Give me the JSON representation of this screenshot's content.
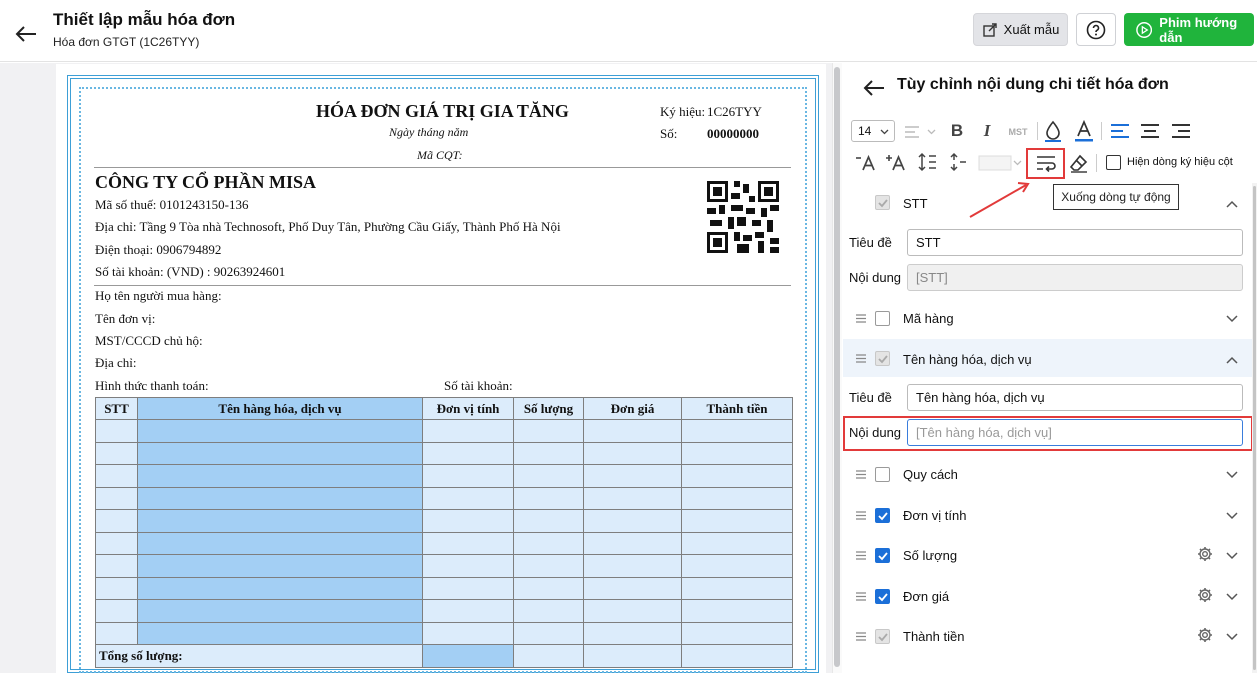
{
  "header": {
    "title": "Thiết lập mẫu hóa đơn",
    "subtitle": "Hóa đơn GTGT (1C26TYY)",
    "export_label": "Xuất mẫu",
    "video_label": "Phim hướng dẫn"
  },
  "invoice": {
    "title": "HÓA ĐƠN GIÁ TRỊ GIA TĂNG",
    "date_line": "Ngày   tháng   năm",
    "cqt_code": "Mã CQT:",
    "symbol_label": "Ký hiệu:",
    "symbol_value": "1C26TYY",
    "number_label": "Số:",
    "number_value": "00000000",
    "company": "CÔNG TY CỔ PHẦN MISA",
    "tax_code": "Mã số thuế: 0101243150-136",
    "address": "Địa chỉ: Tầng 9 Tòa nhà Technosoft, Phố Duy Tân, Phường Cầu Giấy, Thành Phố Hà Nội",
    "phone": "Điện thoại: 0906794892",
    "account": "Số tài khoản: (VND) : 90263924601",
    "buyer": "Họ tên người mua hàng:",
    "unit": "Tên đơn vị:",
    "mst": "MST/CCCD chủ hộ:",
    "buyer_address": "Địa chỉ:",
    "payment": "Hình thức thanh toán:",
    "buyer_account": "Số tài khoản:",
    "columns": [
      "STT",
      "Tên hàng hóa, dịch vụ",
      "Đơn vị tính",
      "Số lượng",
      "Đơn giá",
      "Thành tiền"
    ],
    "total_label": "Tổng số lượng:"
  },
  "panel": {
    "title": "Tùy chỉnh nội dung chi tiết hóa đơn",
    "font_size": "14",
    "mst_label": "MST",
    "show_symbol_row": "Hiện dòng ký hiệu cột",
    "tooltip": "Xuống dòng tự động",
    "label_title": "Tiêu đề",
    "label_content": "Nội dung",
    "stt_title": "STT",
    "stt_content": "[STT]",
    "name_title": "Tên hàng hóa, dịch vụ",
    "name_content": "[Tên hàng hóa, dịch vụ]",
    "fields": [
      "STT",
      "Mã hàng",
      "Tên hàng hóa, dịch vụ",
      "Quy cách",
      "Đơn vị tính",
      "Số lượng",
      "Đơn giá",
      "Thành tiền"
    ]
  }
}
